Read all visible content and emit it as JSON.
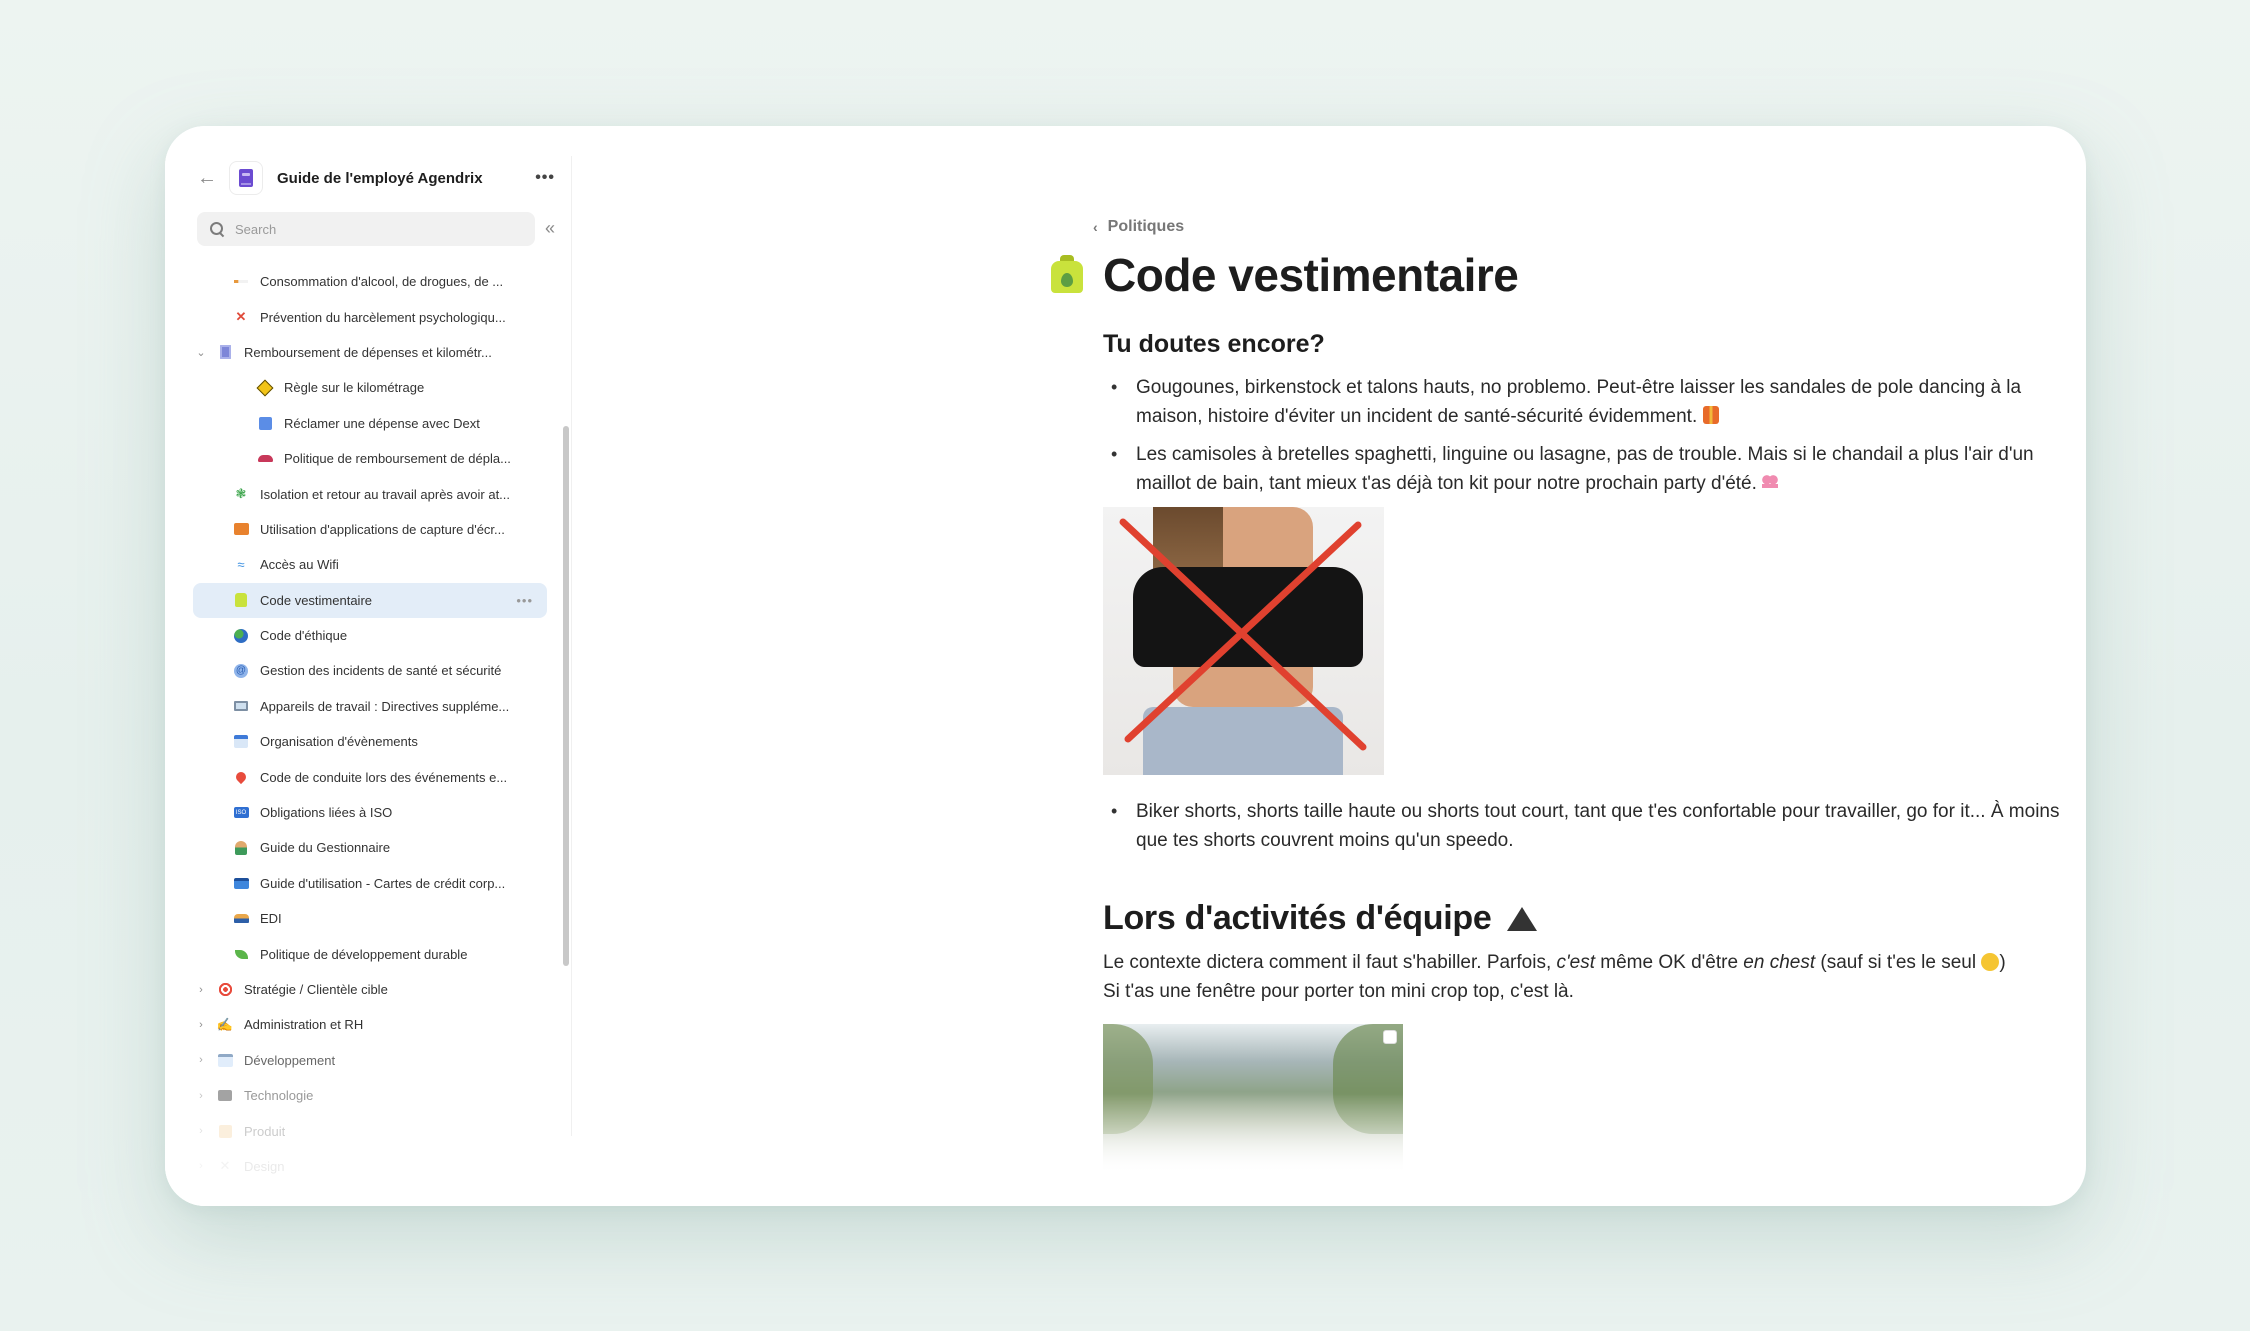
{
  "sidebar": {
    "back_icon": "arrow-left-icon",
    "workspace_icon": "purple-book-icon",
    "title": "Guide de l'employé Agendrix",
    "more_icon": "ellipsis-icon",
    "search": {
      "placeholder": "Search",
      "value": ""
    },
    "collapse_icon": "double-chevron-left-icon",
    "items": [
      {
        "label": "Consommation d'alcool, de drogues, de ...",
        "icon": "cigarette-icon",
        "level": 1
      },
      {
        "label": "Prévention du harcèlement psychologiqu...",
        "icon": "red-x-icon",
        "level": 1
      },
      {
        "label": "Remboursement de dépenses et kilométr...",
        "icon": "document-icon",
        "level": 1,
        "expanded": true
      },
      {
        "label": "Règle sur le kilométrage",
        "icon": "road-sign-icon",
        "level": 2
      },
      {
        "label": "Réclamer une dépense avec Dext",
        "icon": "receipt-icon",
        "level": 2
      },
      {
        "label": "Politique de remboursement de dépla...",
        "icon": "car-icon",
        "level": 2
      },
      {
        "label": "Isolation et retour au travail après avoir at...",
        "icon": "virus-icon",
        "level": 1
      },
      {
        "label": "Utilisation d'applications de capture d'écr...",
        "icon": "photo-icon",
        "level": 1
      },
      {
        "label": "Accès au Wifi",
        "icon": "wifi-icon",
        "level": 1
      },
      {
        "label": "Code vestimentaire",
        "icon": "coat-icon",
        "level": 1,
        "active": true
      },
      {
        "label": "Code d'éthique",
        "icon": "globe-icon",
        "level": 1
      },
      {
        "label": "Gestion des incidents de santé et sécurité",
        "icon": "at-sign-icon",
        "level": 1
      },
      {
        "label": "Appareils de travail : Directives suppléme...",
        "icon": "laptop-icon",
        "level": 1
      },
      {
        "label": "Organisation d'évènements",
        "icon": "calendar-clock-icon",
        "level": 1
      },
      {
        "label": "Code de conduite lors des événements e...",
        "icon": "map-pin-icon",
        "level": 1
      },
      {
        "label": "Obligations liées à ISO",
        "icon": "iso-badge-icon",
        "level": 1
      },
      {
        "label": "Guide du Gestionnaire",
        "icon": "manager-person-icon",
        "level": 1
      },
      {
        "label": "Guide d'utilisation - Cartes de crédit corp...",
        "icon": "credit-card-icon",
        "level": 1
      },
      {
        "label": "EDI",
        "icon": "group-people-icon",
        "level": 1
      },
      {
        "label": "Politique de développement durable",
        "icon": "leaf-icon",
        "level": 1
      },
      {
        "label": "Stratégie / Clientèle cible",
        "icon": "target-icon",
        "level": 0
      },
      {
        "label": "Administration et RH",
        "icon": "writing-hand-icon",
        "level": 0
      },
      {
        "label": "Développement",
        "icon": "browser-window-icon",
        "level": 0
      },
      {
        "label": "Technologie",
        "icon": "terminal-icon",
        "level": 0
      },
      {
        "label": "Produit",
        "icon": "package-icon",
        "level": 0
      },
      {
        "label": "Design",
        "icon": "tools-icon",
        "level": 0
      }
    ],
    "row_more_label": "•••"
  },
  "page": {
    "breadcrumb": "Politiques",
    "emoji": "coat-icon",
    "title": "Code vestimentaire",
    "section1": {
      "heading": "Tu doutes encore?",
      "bullets": [
        "Gougounes, birkenstock et talons hauts, no problemo. Peut-être laisser les sandales de pole dancing à la maison, histoire d'éviter un incident de santé-sécurité évidemment.",
        "Les camisoles à bretelles spaghetti, linguine ou lasagne, pas de trouble. Mais si le chandail a plus l'air d'un maillot de bain, tant mieux t'as déjà ton kit pour notre prochain party d'été.",
        "Biker shorts, shorts taille haute ou shorts tout court, tant que t'es confortable pour travailler, go for it... À moins que tes shorts couvrent moins qu'un speedo."
      ],
      "bullet_emojis": [
        "safety-vest-icon",
        "bikini-icon"
      ],
      "image1_alt": "Crop top crossed out with a red X"
    },
    "section2": {
      "heading": "Lors d'activités d'équipe",
      "heading_emoji": "camping-tent-icon",
      "para_part1": "Le contexte dictera comment il faut s'habiller. Parfois, ",
      "para_em1": "c'est",
      "para_part2": " même OK d'être ",
      "para_em2": "en chest",
      "para_part3": " (sauf si t'es le seul ",
      "para_emoji": "laughing-face-icon",
      "para_part4": ")",
      "para_line2": "Si t'as une fenêtre pour porter ton mini crop top, c'est là.",
      "image2_alt": "Team photo in front of mountains"
    }
  },
  "colors": {
    "background": "#e8f1ee",
    "active_item": "#e3edf8",
    "x_mark": "#e0412f",
    "brand_book": "#6b4bd1"
  }
}
